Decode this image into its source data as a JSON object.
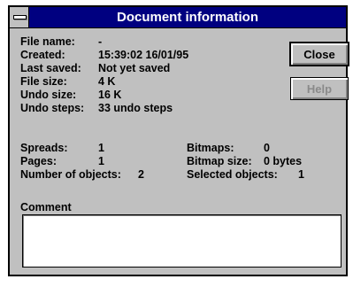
{
  "window": {
    "title": "Document information"
  },
  "info": {
    "file_name_label": "File name:",
    "file_name_value": "-",
    "created_label": "Created:",
    "created_value": "15:39:02  16/01/95",
    "last_saved_label": "Last saved:",
    "last_saved_value": "Not yet saved",
    "file_size_label": "File size:",
    "file_size_value": "4 K",
    "undo_size_label": "Undo size:",
    "undo_size_value": "16 K",
    "undo_steps_label": "Undo steps:",
    "undo_steps_value": "33 undo steps"
  },
  "stats": {
    "spreads_label": "Spreads:",
    "spreads_value": "1",
    "pages_label": "Pages:",
    "pages_value": "1",
    "objects_label": "Number of objects:",
    "objects_value": "2",
    "bitmaps_label": "Bitmaps:",
    "bitmaps_value": "0",
    "bitmap_size_label": "Bitmap size:",
    "bitmap_size_value": "0 bytes",
    "selected_label": "Selected objects:",
    "selected_value": "1"
  },
  "buttons": {
    "close_label": "Close",
    "help_label": "Help"
  },
  "comment": {
    "label": "Comment",
    "value": ""
  }
}
